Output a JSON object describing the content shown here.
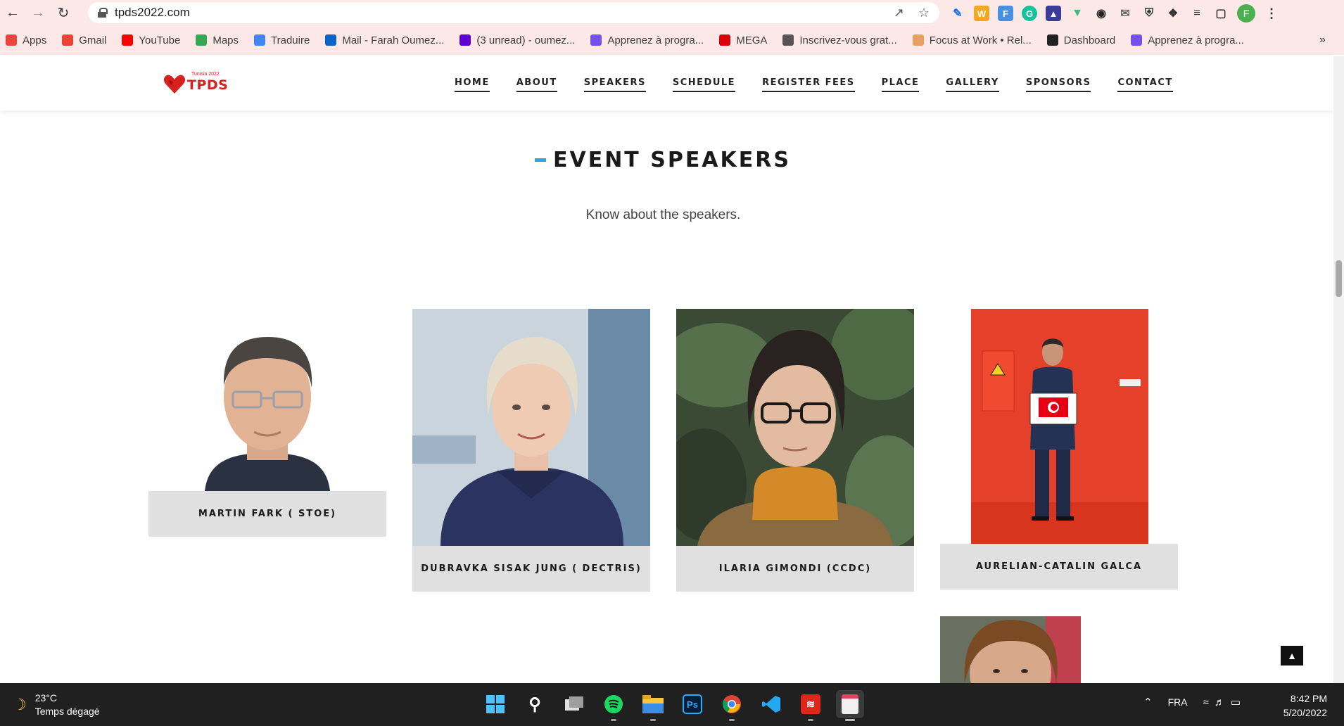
{
  "browser": {
    "url": "tpds2022.com",
    "profile_initial": "F",
    "bookmarks": [
      {
        "label": "Apps",
        "icon": "apps-grid-icon",
        "color": "#e8453c"
      },
      {
        "label": "Gmail",
        "icon": "gmail-icon",
        "color": "#ea4335"
      },
      {
        "label": "YouTube",
        "icon": "youtube-icon",
        "color": "#ff0000"
      },
      {
        "label": "Maps",
        "icon": "maps-icon",
        "color": "#34a853"
      },
      {
        "label": "Traduire",
        "icon": "translate-icon",
        "color": "#4285f4"
      },
      {
        "label": "Mail - Farah Oumez...",
        "icon": "outlook-icon",
        "color": "#0a64c8"
      },
      {
        "label": "(3 unread) - oumez...",
        "icon": "yahoo-mail-icon",
        "color": "#6001d2"
      },
      {
        "label": "Apprenez à progra...",
        "icon": "openclassrooms-icon",
        "color": "#7451eb"
      },
      {
        "label": "MEGA",
        "icon": "mega-icon",
        "color": "#d90007"
      },
      {
        "label": "Inscrivez-vous grat...",
        "icon": "cisco-icon",
        "color": "#555555"
      },
      {
        "label": "Focus at Work • Rel...",
        "icon": "focus-icon",
        "color": "#e8a060"
      },
      {
        "label": "Dashboard",
        "icon": "moodle-icon",
        "color": "#222222"
      },
      {
        "label": "Apprenez à progra...",
        "icon": "openclassrooms-icon",
        "color": "#7451eb"
      }
    ]
  },
  "site": {
    "logo_text": "TPDS",
    "logo_sub": "Tunisia 2022",
    "brand_color": "#d6211f",
    "menu": [
      "HOME",
      "ABOUT",
      "SPEAKERS",
      "SCHEDULE",
      "REGISTER FEES",
      "PLACE",
      "GALLERY",
      "SPONSORS",
      "CONTACT"
    ]
  },
  "section": {
    "title": "EVENT SPEAKERS",
    "subtitle": "Know about the speakers.",
    "accent": "#29a8e0"
  },
  "speakers": [
    {
      "name": "MARTIN FARK ( STOE)"
    },
    {
      "name": "DUBRAVKA SISAK JUNG ( DECTRIS)"
    },
    {
      "name": "ILARIA GIMONDI (CCDC)"
    },
    {
      "name": "AURELIAN-CATALIN GALCA"
    }
  ],
  "taskbar": {
    "temperature": "23°C",
    "weather": "Temps dégagé",
    "language": "FRA",
    "time": "8:42 PM",
    "date": "5/20/2022"
  }
}
